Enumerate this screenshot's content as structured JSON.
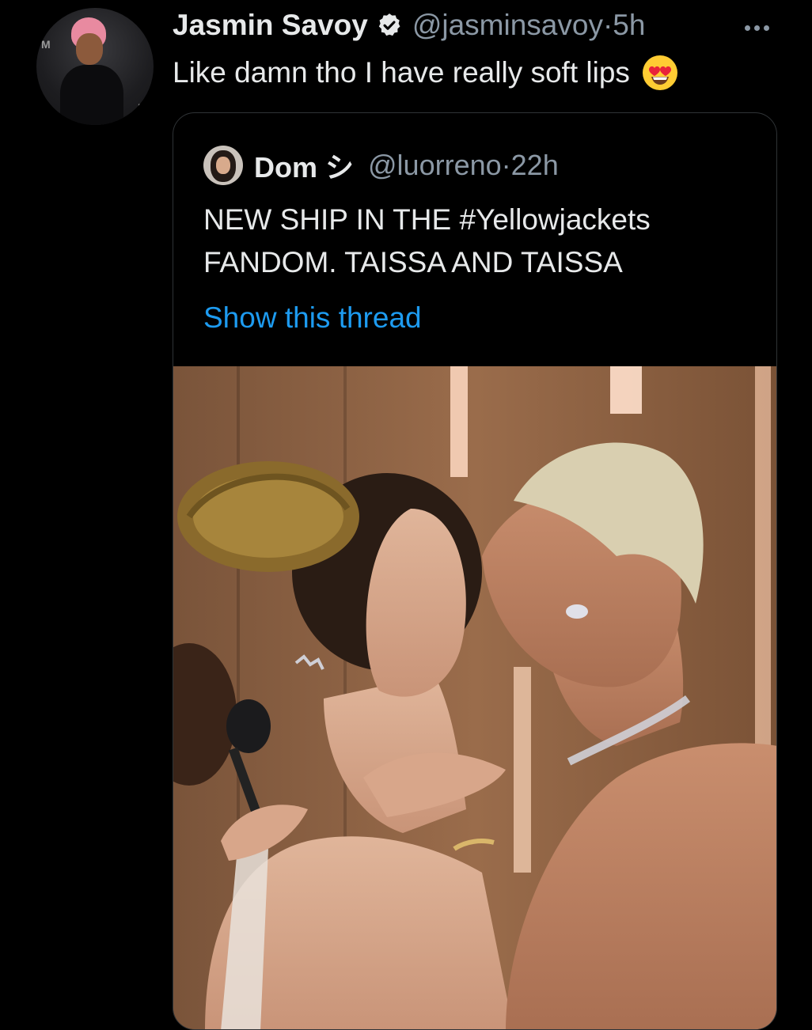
{
  "tweet": {
    "display_name": "Jasmin Savoy",
    "handle": "@jasminsavoy",
    "separator": "·",
    "time": "5h",
    "text": "Like damn tho I have really soft lips",
    "emoji": "smiling-face-with-heart-eyes"
  },
  "avatar": {
    "poster_letter_left": "M",
    "poster_letters_bottom": "RE"
  },
  "quoted_tweet": {
    "display_name": "Dom シ",
    "handle": "@luorreno",
    "separator": "·",
    "time": "22h",
    "text_lines": [
      "NEW SHIP IN THE #Yellowjackets",
      "FANDOM. TAISSA AND TAISSA"
    ],
    "show_thread": "Show this thread",
    "media": "photo"
  },
  "colors": {
    "background": "#000000",
    "text": "#e7e9ea",
    "secondary_text": "#8b98a5",
    "link": "#1d9bf0",
    "verified": "#e7e9ea",
    "border": "#2f3336"
  }
}
